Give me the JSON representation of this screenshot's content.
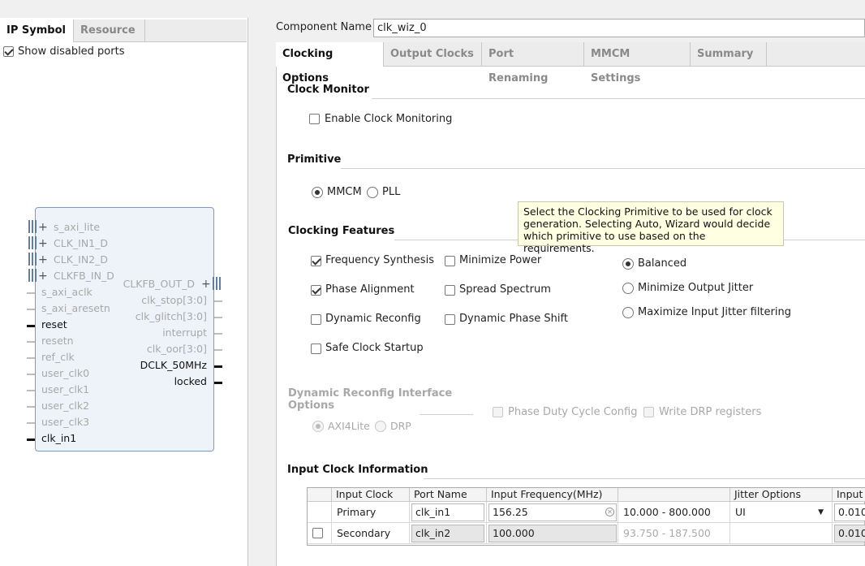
{
  "left": {
    "tabs": [
      "IP Symbol",
      "Resource"
    ],
    "show_disabled_ports_label": "Show disabled ports",
    "show_disabled_ports_checked": true,
    "ports_left": [
      {
        "label": "s_axi_lite",
        "state": "dim",
        "kind": "bus"
      },
      {
        "label": "CLK_IN1_D",
        "state": "dim",
        "kind": "bus"
      },
      {
        "label": "CLK_IN2_D",
        "state": "dim",
        "kind": "bus"
      },
      {
        "label": "CLKFB_IN_D",
        "state": "dim",
        "kind": "bus"
      },
      {
        "label": "s_axi_aclk",
        "state": "dim",
        "kind": "wire"
      },
      {
        "label": "s_axi_aresetn",
        "state": "dim",
        "kind": "wire"
      },
      {
        "label": "reset",
        "state": "on",
        "kind": "wire"
      },
      {
        "label": "resetn",
        "state": "dim",
        "kind": "wire"
      },
      {
        "label": "ref_clk",
        "state": "dim",
        "kind": "wire"
      },
      {
        "label": "user_clk0",
        "state": "dim",
        "kind": "wire"
      },
      {
        "label": "user_clk1",
        "state": "dim",
        "kind": "wire"
      },
      {
        "label": "user_clk2",
        "state": "dim",
        "kind": "wire"
      },
      {
        "label": "user_clk3",
        "state": "dim",
        "kind": "wire"
      },
      {
        "label": "clk_in1",
        "state": "on",
        "kind": "wire"
      }
    ],
    "ports_right": [
      {
        "label": "CLKFB_OUT_D",
        "state": "dim",
        "kind": "bus"
      },
      {
        "label": "clk_stop[3:0]",
        "state": "dim",
        "kind": "wire"
      },
      {
        "label": "clk_glitch[3:0]",
        "state": "dim",
        "kind": "wire"
      },
      {
        "label": "interrupt",
        "state": "dim",
        "kind": "wire"
      },
      {
        "label": "clk_oor[3:0]",
        "state": "dim",
        "kind": "wire"
      },
      {
        "label": "DCLK_50MHz",
        "state": "on",
        "kind": "wire"
      },
      {
        "label": "locked",
        "state": "on",
        "kind": "wire"
      }
    ]
  },
  "component": {
    "label": "Component Name",
    "value": "clk_wiz_0"
  },
  "tabs": [
    "Clocking Options",
    "Output Clocks",
    "Port Renaming",
    "MMCM Settings",
    "Summary"
  ],
  "clock_monitor": {
    "title": "Clock Monitor",
    "enable_label": "Enable Clock Monitoring",
    "enable_checked": false
  },
  "primitive": {
    "title": "Primitive",
    "options": [
      "MMCM",
      "PLL"
    ],
    "selected": "MMCM"
  },
  "tooltip": {
    "lines": [
      "Select the Clocking Primitive to be used for clock",
      "generation. Selecting Auto, Wizard would decide",
      "which primitive to use based on the requirements."
    ]
  },
  "clocking_features": {
    "title": "Clocking Features",
    "col1": [
      {
        "label": "Frequency Synthesis",
        "checked": true
      },
      {
        "label": "Phase Alignment",
        "checked": true
      },
      {
        "label": "Dynamic Reconfig",
        "checked": false
      },
      {
        "label": "Safe Clock Startup",
        "checked": false
      }
    ],
    "col2": [
      {
        "label": "Minimize Power",
        "checked": false
      },
      {
        "label": "Spread Spectrum",
        "checked": false
      },
      {
        "label": "Dynamic Phase Shift",
        "checked": false
      }
    ],
    "jitter": [
      {
        "label": "Balanced",
        "selected": true
      },
      {
        "label": "Minimize Output Jitter",
        "selected": false
      },
      {
        "label": "Maximize Input Jitter filtering",
        "selected": false
      }
    ]
  },
  "drp": {
    "title_line1": "Dynamic Reconfig Interface",
    "title_line2": "Options",
    "options": [
      "AXI4Lite",
      "DRP"
    ],
    "selected": "AXI4Lite",
    "phase_duty_label": "Phase Duty Cycle Config",
    "write_drp_label": "Write DRP registers"
  },
  "input_clock": {
    "title": "Input Clock Information",
    "headers": [
      "Input Clock",
      "Port Name",
      "Input Frequency(MHz)",
      "",
      "Jitter Options",
      "Input"
    ],
    "rows": [
      {
        "clock": "Primary",
        "port": "clk_in1",
        "freq": "156.25",
        "range": "10.000 - 800.000",
        "jitter": "UI",
        "input": "0.010"
      },
      {
        "clock": "Secondary",
        "port": "clk_in2",
        "freq": "100.000",
        "range": "93.750 - 187.500",
        "jitter": "",
        "input": "0.010"
      }
    ]
  }
}
